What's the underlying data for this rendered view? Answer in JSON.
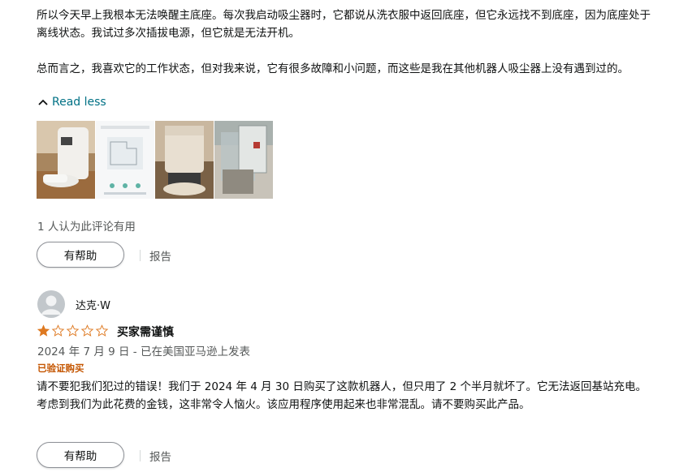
{
  "review1": {
    "text_p1": "所以今天早上我根本无法唤醒主底座。每次我启动吸尘器时，它都说从洗衣服中返回底座，但它永远找不到底座，因为底座处于离线状态。我试过多次插拔电源，但它就是无法开机。",
    "text_p2": "总而言之，我喜欢它的工作状态，但对我来说，它有很多故障和小问题，而这些是我在其他机器人吸尘器上没有遇到过的。",
    "read_less": "Read less",
    "helpful_count": "1 人认为此评论有用",
    "helpful_button": "有帮助",
    "report_link": "报告"
  },
  "review2": {
    "reviewer_name": "达克·W",
    "rating": 1,
    "rating_max": 5,
    "title": "买家需谨慎",
    "date_line": "2024 年 7 月 9 日 - 已在美国亚马逊上发表",
    "verified": "已验证购买",
    "text": "请不要犯我们犯过的错误！我们于 2024 年 4 月 30 日购买了这款机器人，但只用了 2 个半月就坏了。它无法返回基站充电。考虑到我们为此花费的金钱，这非常令人恼火。该应用程序使用起来也非常混乱。请不要购买此产品。",
    "helpful_button": "有帮助",
    "report_link": "报告"
  },
  "colors": {
    "link": "#007185",
    "star": "#de7921",
    "verified": "#c45500",
    "muted": "#565959"
  }
}
